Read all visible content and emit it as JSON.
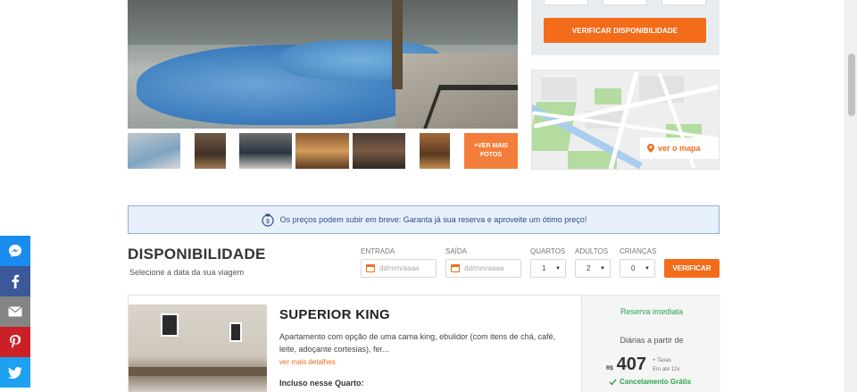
{
  "gallery": {
    "more_photos_label": "+VER MAIS FOTOS"
  },
  "booking": {
    "check_availability_button": "VERIFICAR DISPONIBILIDADE"
  },
  "map": {
    "see_map_label": "ver o mapa"
  },
  "notice": {
    "text": "Os preços podem subir em breve: Garanta já sua reserva e aproveite um ótimo preço!"
  },
  "availability": {
    "title": "DISPONIBILIDADE",
    "subtitle": "Selecione a data da sua viagem",
    "fields": {
      "checkin_label": "ENTRADA",
      "checkin_placeholder": "dd/mm/aaaa",
      "checkout_label": "SAÍDA",
      "checkout_placeholder": "dd/mm/aaaa",
      "rooms_label": "QUARTOS",
      "rooms_value": "1",
      "adults_label": "ADULTOS",
      "adults_value": "2",
      "children_label": "CRIANÇAS",
      "children_value": "0"
    },
    "verify_button": "VERIFICAR"
  },
  "room": {
    "name": "SUPERIOR KING",
    "description": "Apartamento com opção de uma cama king, ebulidor (com itens de chá, café, leite, adoçante cortesias), fer...",
    "more_details": "ver mais detalhes",
    "included_label": "Incluso nesse Quarto:",
    "reserve_label": "Reserva imediata",
    "from_label": "Diárias a partir de",
    "currency": "R$",
    "price": "407",
    "taxes_note": "+ Taxas",
    "installments_note": "Em até 12x",
    "cancellation": "Cancelamento Grátis"
  },
  "colors": {
    "accent": "#f26c1a",
    "success": "#2ea44f",
    "notice_bg": "#e8f0fb"
  }
}
